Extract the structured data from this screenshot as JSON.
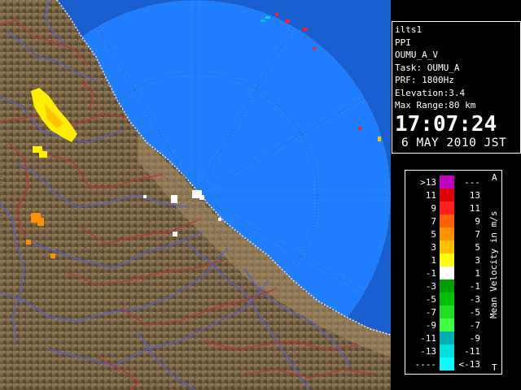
{
  "info": {
    "station": "ilts1",
    "mode": "PPI",
    "product": "OUMU_A_V",
    "task": "Task: OUMU_A",
    "prf": "PRF: 1800Hz",
    "elevation": "Elevation:3.4",
    "max_range": "Max Range:80 km",
    "time": "17:07:24",
    "date": "6 MAY 2010 JST"
  },
  "legend": {
    "title": "Mean Velocity in m/s",
    "top_marker": "A",
    "bottom_marker": "T",
    "left_labels": [
      ">13",
      "11",
      "9",
      "7",
      "5",
      "3",
      "1",
      "-1",
      "-3",
      "-5",
      "-7",
      "-9",
      "-11",
      "-13",
      "----"
    ],
    "right_labels": [
      "---",
      "13",
      "11",
      "9",
      "7",
      "5",
      "3",
      "1",
      "-1",
      "-3",
      "-5",
      "-7",
      "-9",
      "-11",
      "<-13"
    ],
    "colors": [
      "#c000c0",
      "#e00000",
      "#ff2020",
      "#ff6000",
      "#ff9000",
      "#ffc000",
      "#ffff00",
      "#ffffff",
      "#00a000",
      "#00c000",
      "#20e020",
      "#40ff40",
      "#00b0b0",
      "#00e0e0",
      "#00ffff"
    ]
  },
  "colors": {
    "ocean": "#1f7fff",
    "far_ocean": "#1a5fd0",
    "land": "#7a6648",
    "rivers": "#5060e0",
    "boundaries": "#d03030"
  }
}
